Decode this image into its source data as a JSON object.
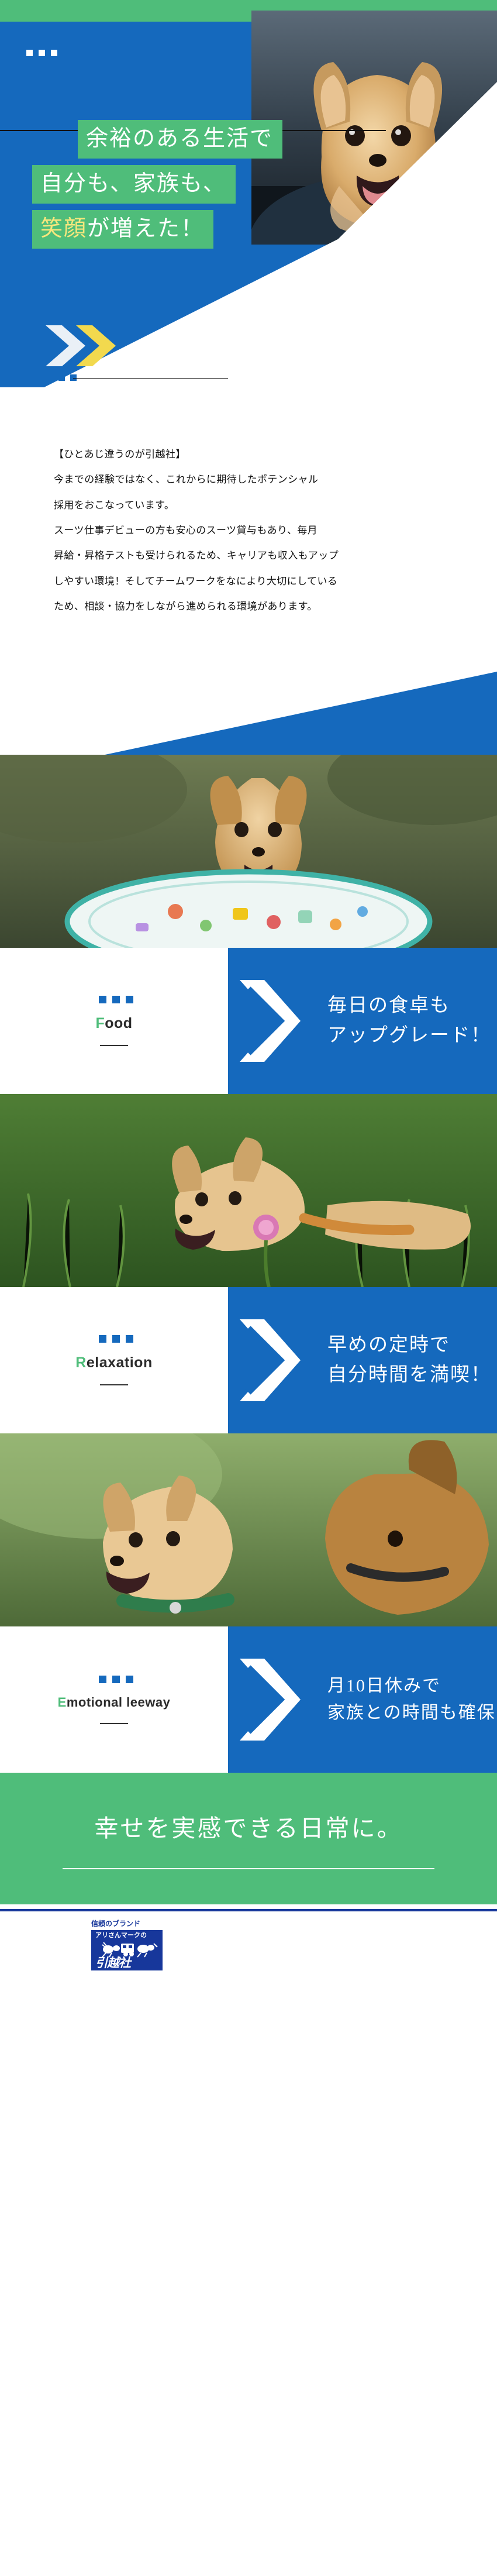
{
  "hero": {
    "headline_lines": [
      {
        "text": "余裕のある生活で",
        "accent": ""
      },
      {
        "text": "自分も、家族も、",
        "accent": ""
      },
      {
        "accent": "笑顔",
        "text": "が増えた！"
      }
    ],
    "photo_alt": "smiling-chihuahua-in-car"
  },
  "intro": {
    "lines": [
      "【ひとあじ違うのが引越社】",
      "今までの経験ではなく、これからに期待したポテンシャル",
      "採用をおこなっています。",
      "スーツ仕事デビューの方も安心のスーツ貸与もあり、毎月",
      "昇給・昇格テストも受けられるため、キャリアも収入もアップ",
      "しやすい環境！そしてチームワークをなにより大切にしている",
      "ため、相談・協力をしながら進められる環境があります。"
    ]
  },
  "features": [
    {
      "label_cap": "F",
      "label_rest": "ood",
      "photo_alt": "dog-behind-decorated-plate-of-food",
      "heading_lines": [
        "毎日の食卓も",
        "アップグレード！"
      ]
    },
    {
      "label_cap": "R",
      "label_rest": "elaxation",
      "photo_alt": "dog-in-grass-with-pink-clover-flower",
      "heading_lines": [
        "早めの定時で",
        "自分時間を満喫！"
      ]
    },
    {
      "label_cap": "E",
      "label_rest": "motional leeway",
      "photo_alt": "two-dogs-with-collars-side-by-side",
      "heading_lines": [
        "月10日休みで",
        "家族との時間も確保！"
      ]
    }
  ],
  "closer": {
    "text": "幸せを実感できる日常に。"
  },
  "footer": {
    "brand_tagline": "信頼のブランド",
    "logo_top": "アリさんマークの",
    "logo_main": "引越社"
  },
  "colors": {
    "blue": "#1569bd",
    "green": "#4fbd7a",
    "yellow": "#f7e77d",
    "logo_navy": "#17379b",
    "white": "#ffffff"
  }
}
